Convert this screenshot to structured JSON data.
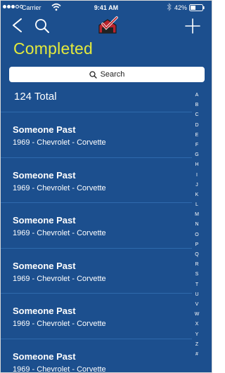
{
  "status_bar": {
    "carrier": "Carrier",
    "time": "9:41 AM",
    "battery": "42%"
  },
  "nav": {
    "icons": [
      "back-icon",
      "search-icon",
      "app-logo-icon",
      "add-icon"
    ]
  },
  "title": "Completed",
  "search": {
    "placeholder": "Search"
  },
  "total": "124 Total",
  "entries": [
    {
      "name": "Someone Past",
      "vehicle": "1969 - Chevrolet - Corvette"
    },
    {
      "name": "Someone Past",
      "vehicle": "1969 - Chevrolet - Corvette"
    },
    {
      "name": "Someone Past",
      "vehicle": "1969 - Chevrolet - Corvette"
    },
    {
      "name": "Someone Past",
      "vehicle": "1969 - Chevrolet - Corvette"
    },
    {
      "name": "Someone Past",
      "vehicle": "1969 - Chevrolet - Corvette"
    },
    {
      "name": "Someone Past",
      "vehicle": "1969 - Chevrolet - Corvette"
    }
  ],
  "index_letters": [
    "A",
    "B",
    "C",
    "D",
    "E",
    "F",
    "G",
    "H",
    "I",
    "J",
    "K",
    "L",
    "M",
    "N",
    "O",
    "P",
    "Q",
    "R",
    "S",
    "T",
    "U",
    "V",
    "W",
    "X",
    "Y",
    "Z",
    "#"
  ],
  "colors": {
    "background": "#1c4f8e",
    "title": "#e4ea3c",
    "row_divider": "#2f6aad"
  }
}
